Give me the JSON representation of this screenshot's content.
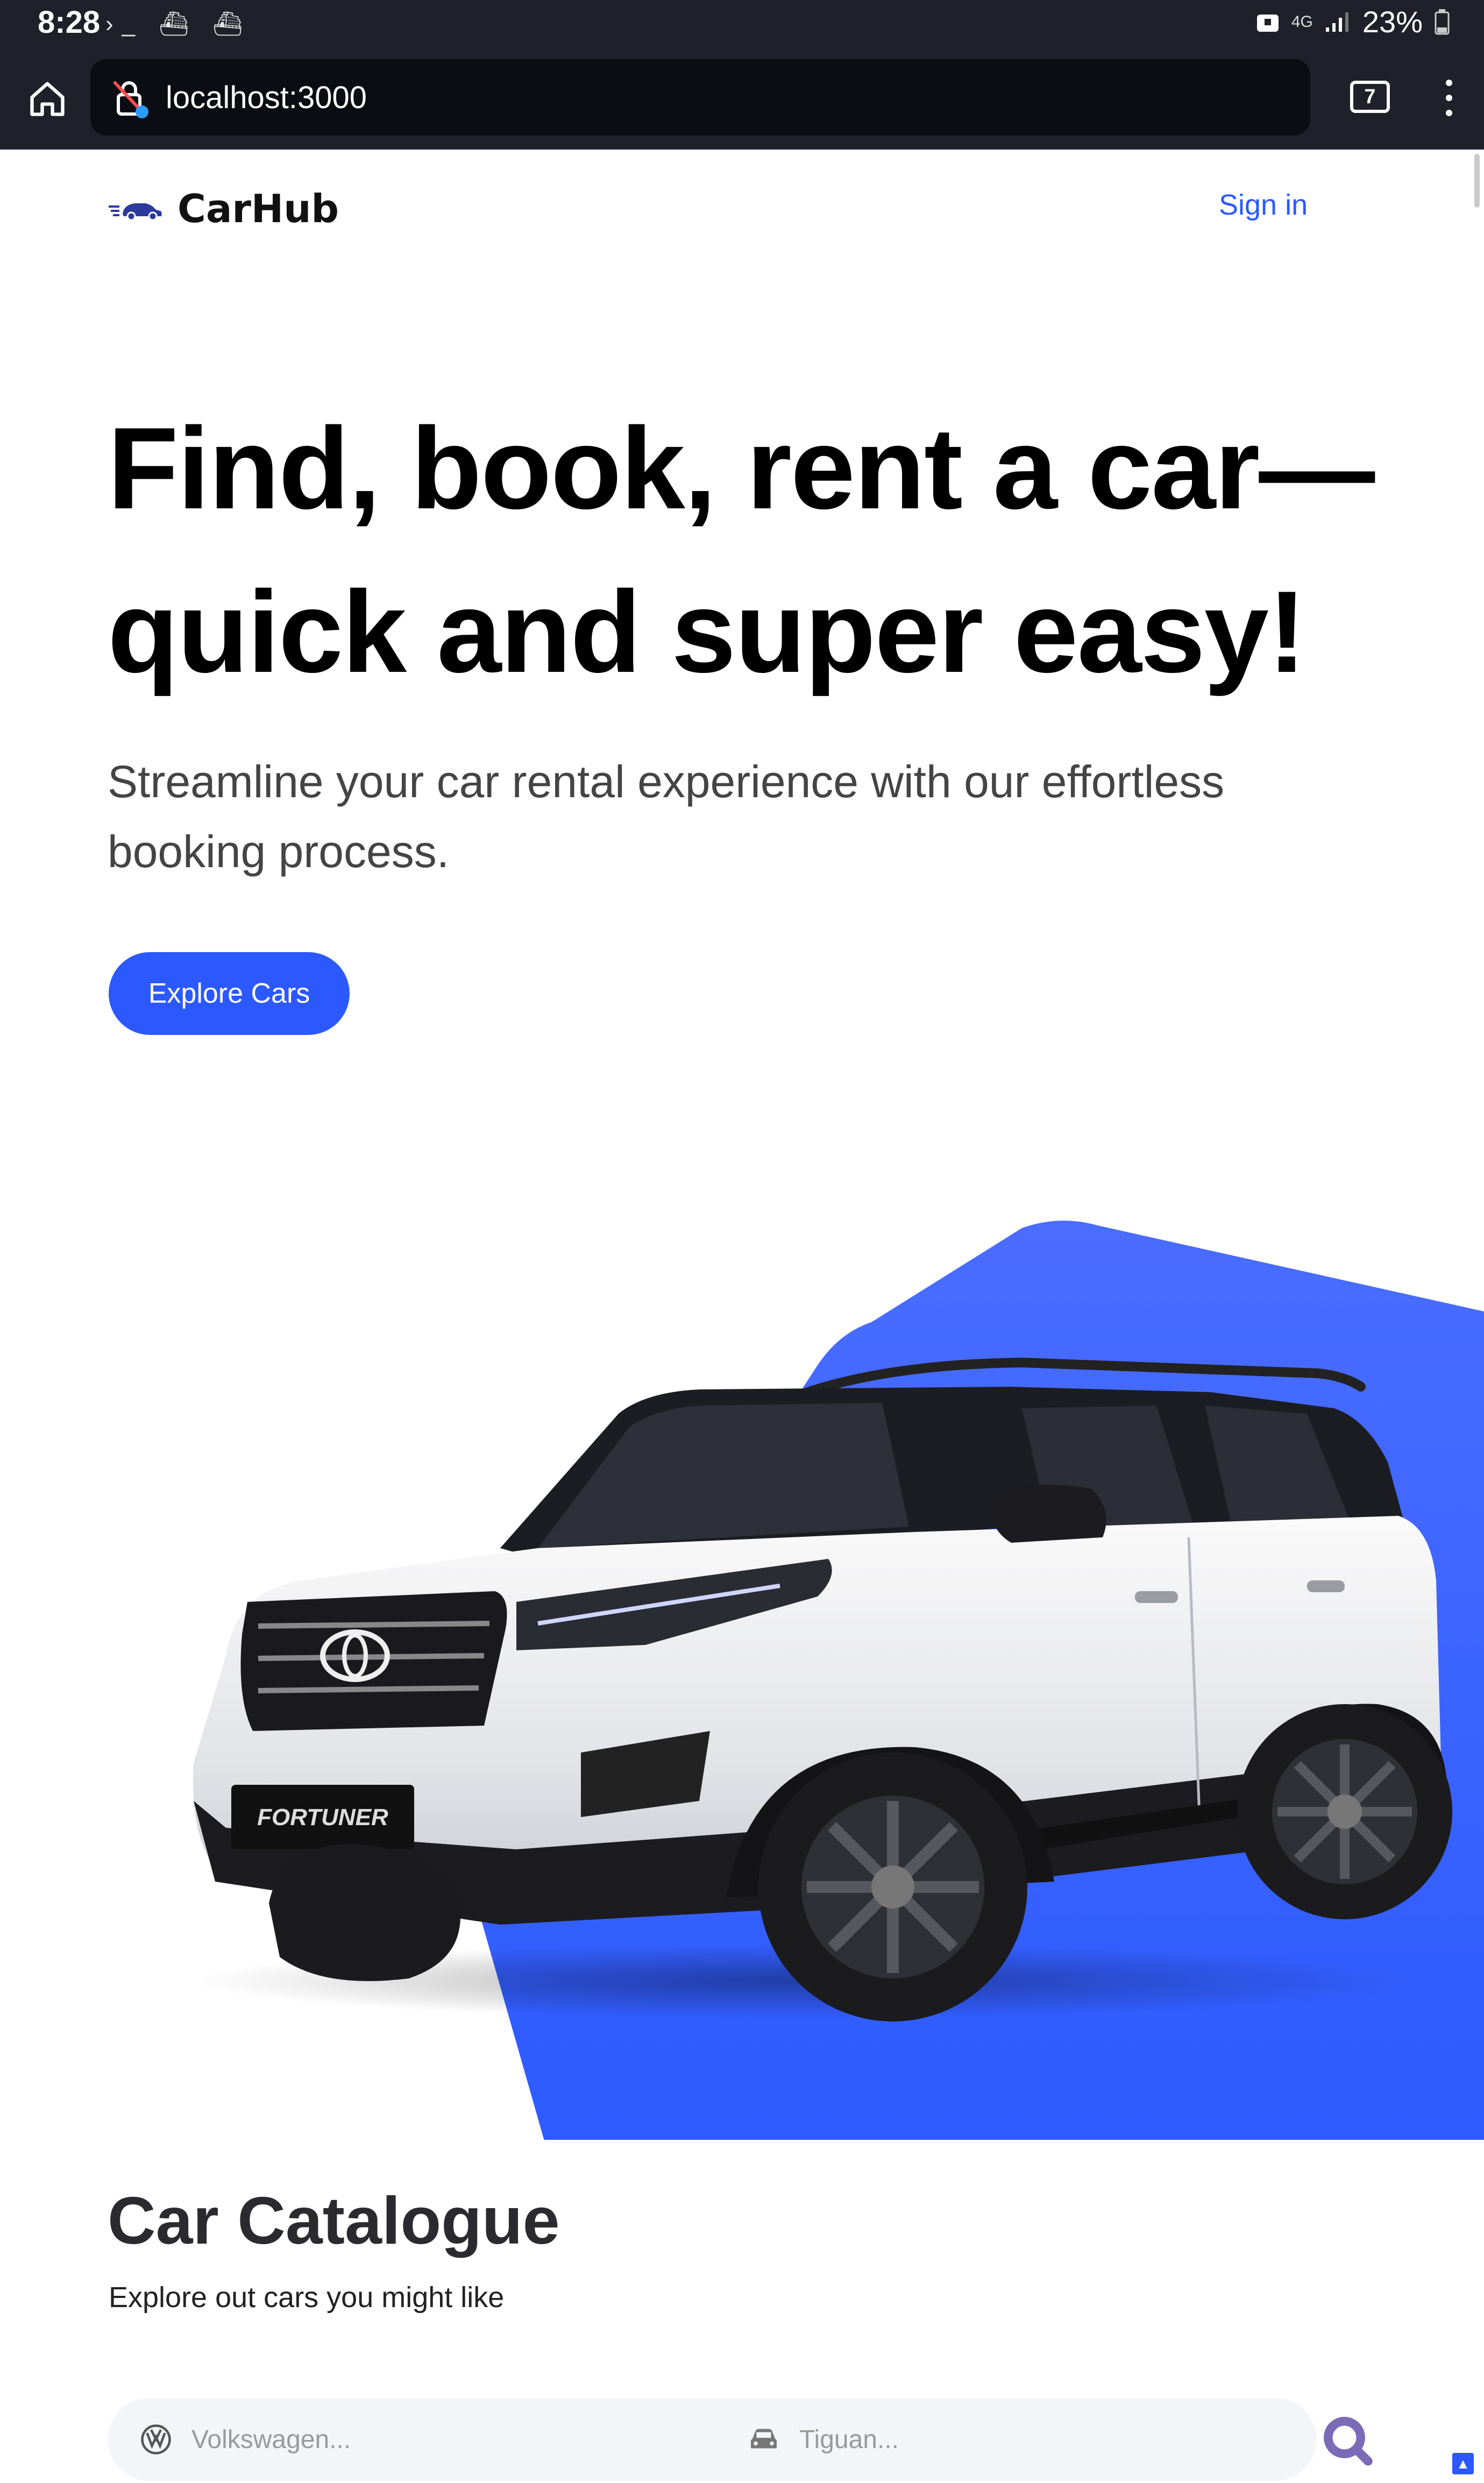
{
  "status_bar": {
    "time": "8:28",
    "left_icons": "›_ ⛴ ⛴",
    "network": "4G",
    "battery": "23%"
  },
  "browser": {
    "url": "localhost:3000",
    "tab_count": "7"
  },
  "navbar": {
    "logo_text": "CarHub",
    "signin_label": "Sign in"
  },
  "hero": {
    "title": "Find, book, rent a car—quick and super easy!",
    "subtitle": "Streamline your car rental experience with our effortless booking process.",
    "cta_label": "Explore Cars",
    "car_badge": "FORTUNER",
    "accent_color": "#2b59ff"
  },
  "catalogue": {
    "title": "Car Catalogue",
    "subtitle": "Explore out cars you might like",
    "make_placeholder": "Volkswagen...",
    "model_placeholder": "Tiguan..."
  }
}
